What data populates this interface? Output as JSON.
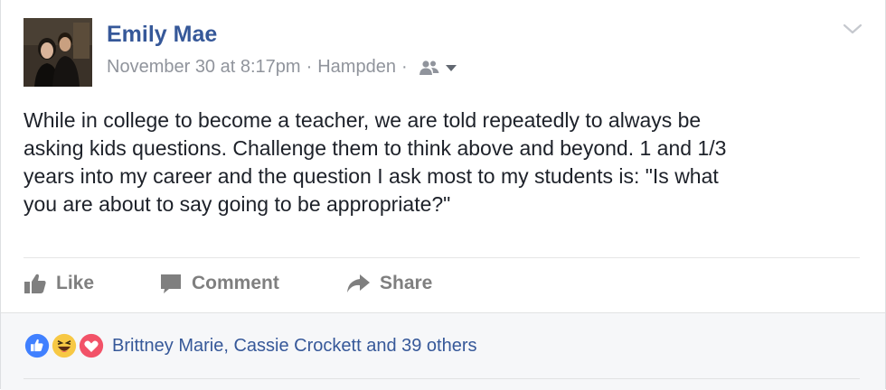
{
  "post": {
    "author": "Emily Mae",
    "date": "November 30 at 8:17pm",
    "separator": "·",
    "location": "Hampden",
    "body_lines": [
      "While in college to become a teacher, we are told repeatedly to always be",
      "asking kids questions. Challenge them to think above and beyond. 1 and 1/3",
      "years into my career and the question I ask most to my students is: \"Is what",
      "you are about to say going to be appropriate?\""
    ]
  },
  "actions": {
    "like": "Like",
    "comment": "Comment",
    "share": "Share"
  },
  "reactions": {
    "summary": "Brittney Marie, Cassie Crockett and 39 others",
    "icons": [
      "like-reaction-icon",
      "haha-reaction-icon",
      "love-reaction-icon"
    ]
  },
  "colors": {
    "link_blue": "#365899",
    "meta_gray": "#90949c",
    "action_gray": "#7f7f7f",
    "like_blue": "#4080ff",
    "haha_yellow": "#f7c844",
    "love_red": "#f25268"
  }
}
